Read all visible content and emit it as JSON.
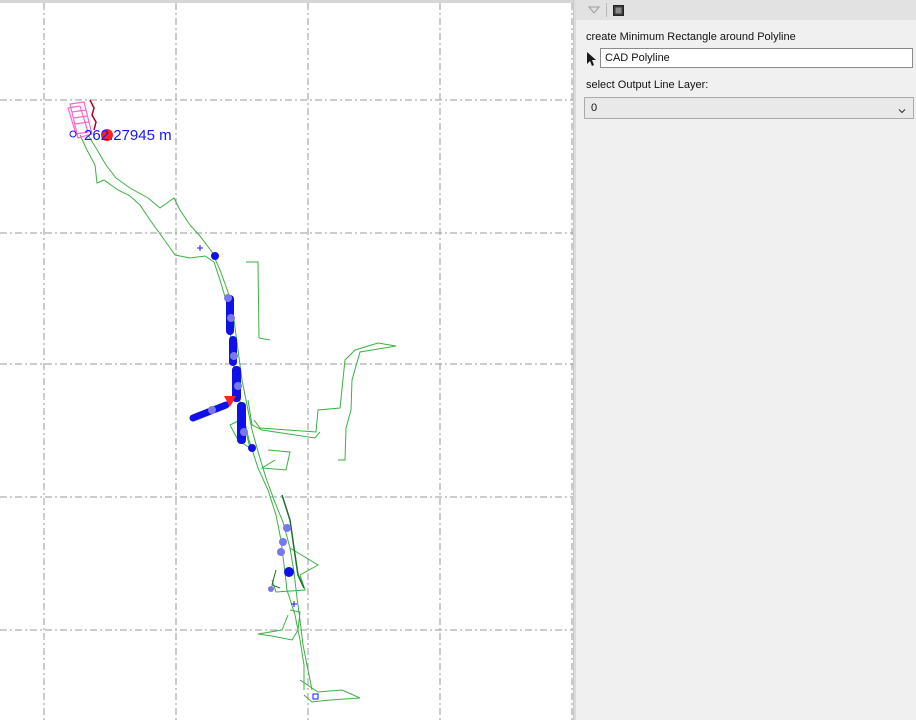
{
  "viewport": {
    "measure_text": "262.27945 m",
    "colors": {
      "grid": "#9a9a9a",
      "route": "#3cb043",
      "route_dark": "#1d6e2a",
      "marker_dark": "#1010e8",
      "marker_light": "#7878ea",
      "highlight": "#ff2020",
      "selection": "#ff66cc",
      "dim_text": "#1515ff"
    }
  },
  "panel": {
    "toolbar": {
      "collapse_icon": "chevron-down-outline-icon",
      "pin_icon": "window-pin-icon"
    },
    "title": "create Minimum Rectangle around Polyline",
    "polyline_field": {
      "picker_icon": "cursor-arrow-icon",
      "value": "CAD Polyline"
    },
    "layer_label": "select Output Line Layer:",
    "layer_select": {
      "value": "0",
      "chevron_icon": "chevron-down-icon"
    }
  }
}
